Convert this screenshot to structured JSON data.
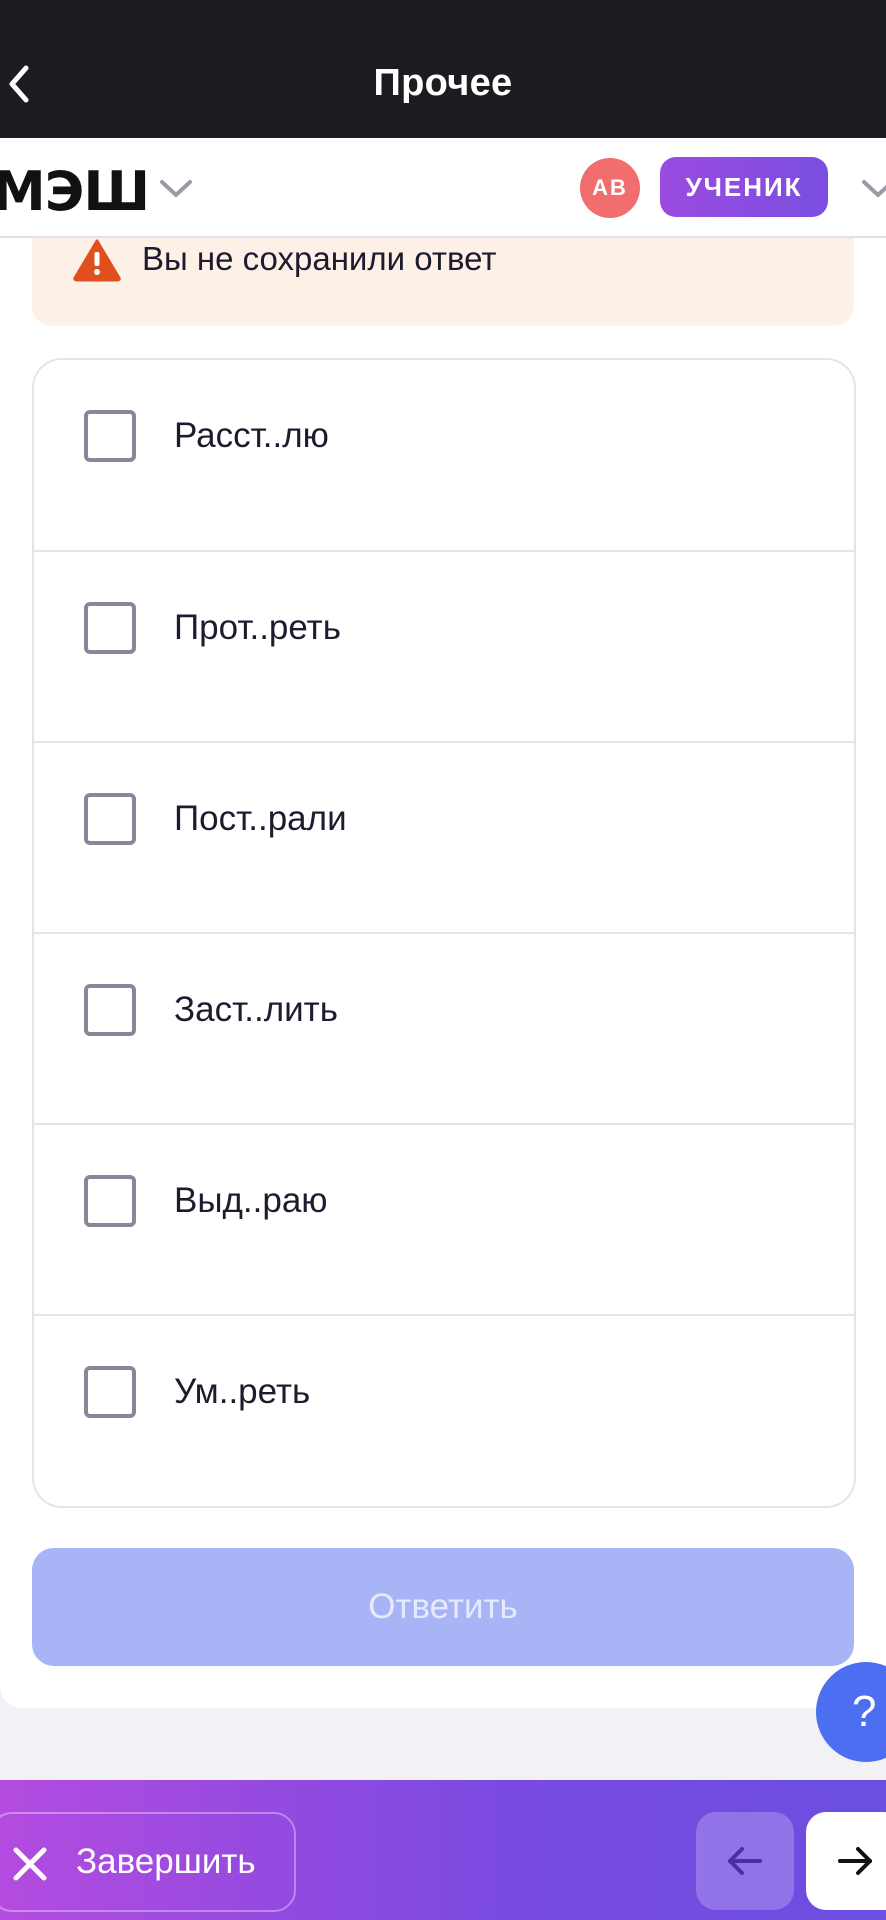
{
  "topbar": {
    "title": "Прочее"
  },
  "header": {
    "logo": "МЭШ",
    "avatar_initials": "АВ",
    "role": "УЧЕНИК"
  },
  "warning": {
    "text": "Вы не сохранили ответ"
  },
  "options": [
    {
      "label": "Расст..лю",
      "checked": false
    },
    {
      "label": "Прот..реть",
      "checked": false
    },
    {
      "label": "Пост..рали",
      "checked": false
    },
    {
      "label": "Заст..лить",
      "checked": false
    },
    {
      "label": "Выд..раю",
      "checked": false
    },
    {
      "label": "Ум..реть",
      "checked": false
    }
  ],
  "answer_button": {
    "label": "Ответить"
  },
  "help_button": {
    "label": "?"
  },
  "bottombar": {
    "finish_label": "Завершить"
  },
  "colors": {
    "accent": "#7a4fe0",
    "answer_disabled": "#a7b4f5",
    "warning_bg": "#fdf0e7",
    "warning_icon": "#e0501e"
  }
}
